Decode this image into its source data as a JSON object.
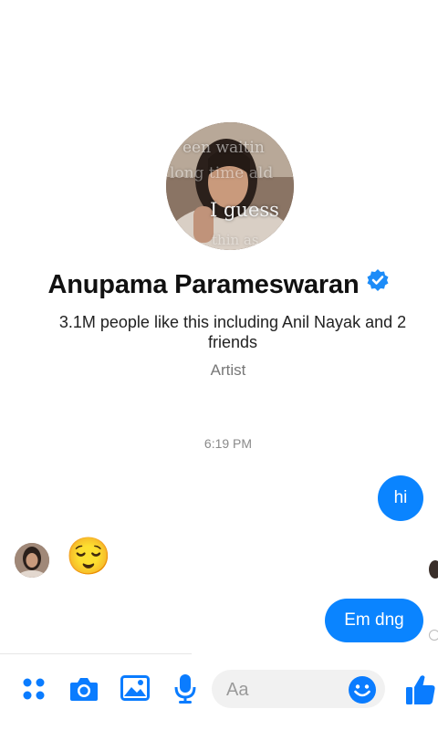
{
  "profile": {
    "name": "Anupama Parameswaran",
    "likes_text": "3.1M people like this including Anil Nayak and 2 friends",
    "category": "Artist",
    "avatar_overlay": {
      "line1": "een waitin",
      "line2": "long time ald",
      "line3": "I guess",
      "line4": "thin as"
    }
  },
  "conversation": {
    "timestamp": "6:19 PM",
    "messages": [
      {
        "from": "me",
        "text": "hi"
      },
      {
        "from": "them",
        "text": "😌"
      },
      {
        "from": "me",
        "text": "Em dng"
      }
    ]
  },
  "composer": {
    "placeholder": "Aa"
  },
  "icons": {
    "apps": "grid-icon",
    "camera": "camera-icon",
    "gallery": "image-icon",
    "voice": "microphone-icon",
    "emoji": "smiley-icon",
    "like": "thumbs-up-icon",
    "verified": "verified-badge-icon"
  },
  "colors": {
    "accent": "#0a84ff",
    "toolbar_icon": "#0a7cff"
  }
}
